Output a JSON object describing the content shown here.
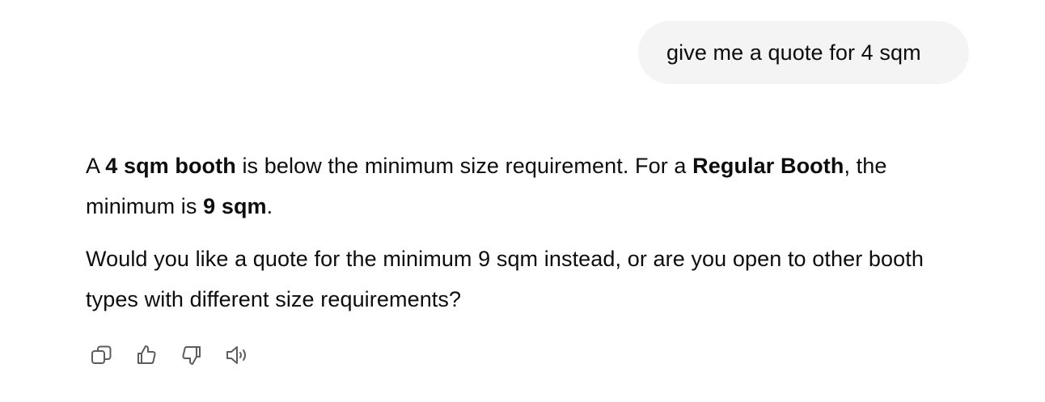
{
  "user_message": {
    "text": "give me a quote for 4 sqm"
  },
  "assistant_message": {
    "paragraph1": {
      "t1": "A ",
      "b1": "4 sqm booth",
      "t2": " is below the minimum size requirement. For a ",
      "b2": "Regular Booth",
      "t3": ", the minimum is ",
      "b3": "9 sqm",
      "t4": "."
    },
    "paragraph2": "Would you like a quote for the minimum 9 sqm instead, or are you open to other booth types with different size requirements?"
  },
  "actions": [
    {
      "icon": "copy-icon"
    },
    {
      "icon": "thumbs-up-icon"
    },
    {
      "icon": "thumbs-down-icon"
    },
    {
      "icon": "speaker-icon"
    }
  ]
}
